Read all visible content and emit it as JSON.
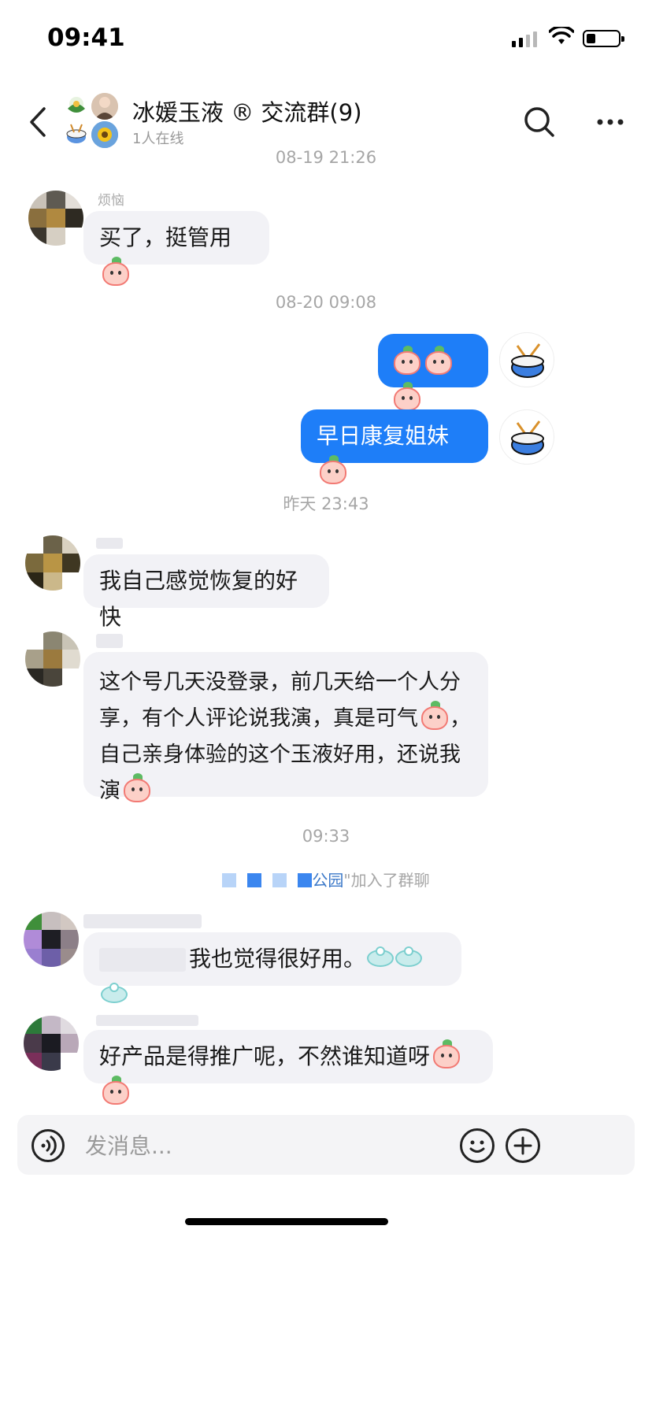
{
  "status": {
    "time": "09:41"
  },
  "header": {
    "title": "冰媛玉液 ® 交流群(9)",
    "subtitle": "1人在线"
  },
  "messages": {
    "ts1": "08-19 21:26",
    "m1_sender": "烦恼",
    "m1_text": "买了，挺管用",
    "ts2": "08-20 09:08",
    "m3_text": "早日康复姐妹",
    "ts3": "昨天 23:43",
    "m4_text": "我自己感觉恢复的好快",
    "m5_text_a": "这个号几天没登录，前几天给一个人分享，有个人评论说我演，真是可气",
    "m5_text_b": "，自己亲身体验的这个玉液好用，还说我演",
    "ts4": "09:33",
    "join_name": "公园",
    "join_text": "\"加入了群聊",
    "m6_text": "我也觉得很好用。",
    "m7_text": "好产品是得推广呢，不然谁知道呀"
  },
  "input": {
    "placeholder": "发消息..."
  },
  "icons": {
    "back": "back-arrow-icon",
    "search": "search-icon",
    "more": "more-icon",
    "voice": "voice-icon",
    "emoji": "emoji-icon",
    "plus": "plus-icon"
  },
  "colors": {
    "accent": "#1e7ef8",
    "bubble_in": "#f2f2f6",
    "muted": "#a6a6a6"
  }
}
